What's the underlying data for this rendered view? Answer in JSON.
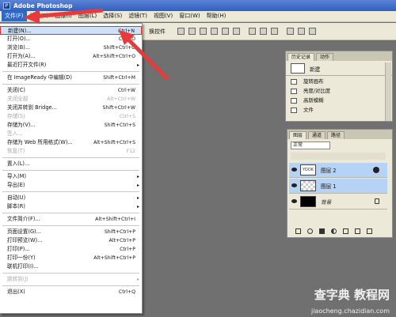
{
  "window": {
    "title": "Adobe Photoshop"
  },
  "menubar": [
    {
      "label": "文件(F)",
      "active": true
    },
    {
      "label": "编辑(E)"
    },
    {
      "label": "图像(I)"
    },
    {
      "label": "图层(L)"
    },
    {
      "label": "选择(S)"
    },
    {
      "label": "滤镜(T)"
    },
    {
      "label": "视图(V)"
    },
    {
      "label": "窗口(W)"
    },
    {
      "label": "帮助(H)"
    }
  ],
  "options": {
    "label": "换控件"
  },
  "file_menu": {
    "items": [
      {
        "label": "新建(N)...",
        "shortcut": "Ctrl+N",
        "highlight": true
      },
      {
        "label": "打开(O)...",
        "shortcut": "Ctrl+O"
      },
      {
        "label": "浏览(B)...",
        "shortcut": "Shift+Ctrl+O"
      },
      {
        "label": "打开为(A)...",
        "shortcut": "Alt+Shift+Ctrl+O"
      },
      {
        "label": "最近打开文件(R)",
        "submenu": true
      },
      {
        "sep": true
      },
      {
        "label": "在 ImageReady 中编辑(D)",
        "shortcut": "Shift+Ctrl+M"
      },
      {
        "sep": true
      },
      {
        "label": "关闭(C)",
        "shortcut": "Ctrl+W"
      },
      {
        "label": "关闭全部",
        "shortcut": "Alt+Ctrl+W",
        "disabled": true
      },
      {
        "label": "关闭并转到 Bridge...",
        "shortcut": "Shift+Ctrl+W"
      },
      {
        "label": "存储(S)",
        "shortcut": "Ctrl+S",
        "disabled": true
      },
      {
        "label": "存储为(V)...",
        "shortcut": "Shift+Ctrl+S"
      },
      {
        "label": "签入...",
        "disabled": true
      },
      {
        "label": "存储为 Web 所用格式(W)...",
        "shortcut": "Alt+Shift+Ctrl+S"
      },
      {
        "label": "恢复(T)",
        "shortcut": "F12",
        "disabled": true
      },
      {
        "sep": true
      },
      {
        "label": "置入(L)..."
      },
      {
        "sep": true
      },
      {
        "label": "导入(M)",
        "submenu": true
      },
      {
        "label": "导出(E)",
        "submenu": true
      },
      {
        "sep": true
      },
      {
        "label": "自动(U)",
        "submenu": true
      },
      {
        "label": "脚本(R)",
        "submenu": true
      },
      {
        "sep": true
      },
      {
        "label": "文件简介(F)...",
        "shortcut": "Alt+Shift+Ctrl+I"
      },
      {
        "sep": true
      },
      {
        "label": "页面设置(G)...",
        "shortcut": "Shift+Ctrl+P"
      },
      {
        "label": "打印预览(W)...",
        "shortcut": "Alt+Ctrl+P"
      },
      {
        "label": "打印(P)...",
        "shortcut": "Ctrl+P"
      },
      {
        "label": "打印一份(Y)",
        "shortcut": "Alt+Shift+Ctrl+P"
      },
      {
        "label": "联机打印(I)..."
      },
      {
        "sep": true
      },
      {
        "label": "跳转到(J)",
        "submenu": true,
        "disabled": true
      },
      {
        "sep": true
      },
      {
        "label": "退出(X)",
        "shortcut": "Ctrl+Q"
      }
    ]
  },
  "history_panel": {
    "tabs": [
      "历史记录",
      "动作"
    ],
    "snapshot": "新建",
    "items": [
      "旋转画布",
      "亮度/对比度",
      "高斯模糊",
      "文件"
    ]
  },
  "layers_panel": {
    "tabs": [
      "图层",
      "通道",
      "路径"
    ],
    "blend_mode": "正常",
    "layers": [
      {
        "name": "图层 2",
        "thumb_text": "YOOK",
        "selected": true
      },
      {
        "name": "图层 1",
        "selected": true
      },
      {
        "name": "背景",
        "locked": true
      }
    ]
  },
  "watermark": {
    "line1": "查字典 教程网",
    "line2": "jiaocheng.chazidian.com"
  },
  "colors": {
    "highlight_border": "#e03030",
    "selection": "#316ac5",
    "arrow": "#e83a3a"
  }
}
